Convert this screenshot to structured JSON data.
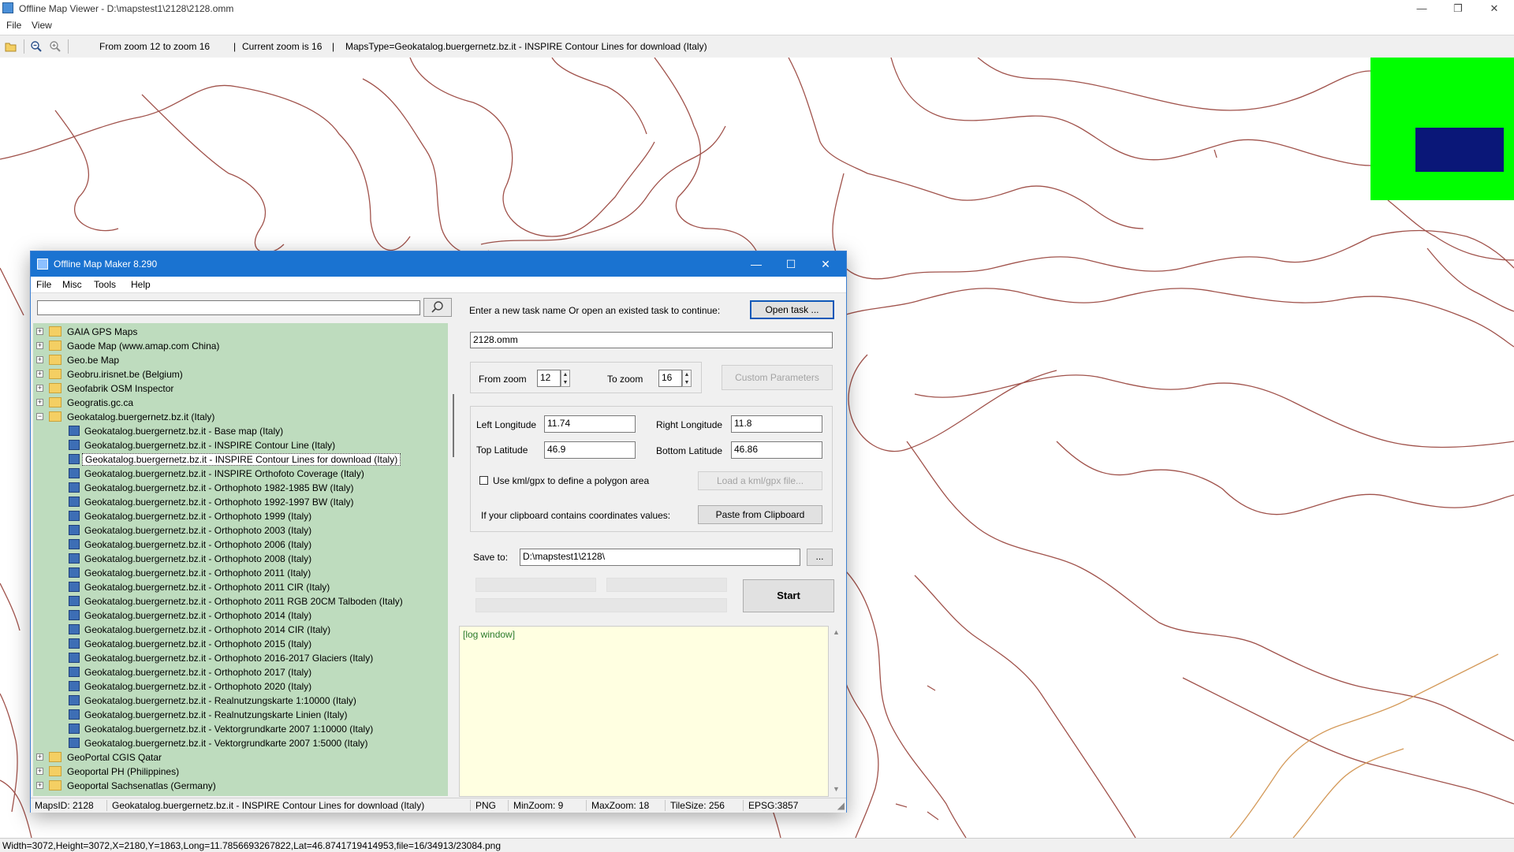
{
  "outer": {
    "title": "Offline Map Viewer - D:\\mapstest1\\2128\\2128.omm",
    "menu": [
      "File",
      "View"
    ],
    "toolbar": {
      "zoom_range": "From zoom 12 to zoom 16",
      "current_zoom": "Current zoom is 16",
      "maps_type": "MapsType=Geokatalog.buergernetz.bz.it - INSPIRE Contour Lines for download (Italy)",
      "sep1": "|",
      "sep2": "|"
    },
    "window_buttons": {
      "minimize": "—",
      "restore": "❐",
      "close": "✕"
    },
    "status": "Width=3072,Height=3072,X=2180,Y=1863,Long=11.7856693267822,Lat=46.8741719414953,file=16/34913/23084.png"
  },
  "colors": {
    "contour": "#a0524b",
    "contour_light": "#d49a5a",
    "minimap_bg": "#00ff00",
    "minimap_view": "#0a1778",
    "tree_bg": "#bedcbe",
    "titlebar": "#1a73d1",
    "log_bg": "#ffffe1"
  },
  "dialog": {
    "title": "Offline Map Maker 8.290",
    "window_buttons": {
      "minimize": "—",
      "maximize": "☐",
      "close": "✕"
    },
    "menu": [
      "File",
      "Misc",
      "Tools",
      "Help"
    ],
    "search": {
      "value": "",
      "placeholder": ""
    },
    "tree": [
      {
        "label": "GAIA GPS Maps",
        "kind": "folder",
        "level": 0,
        "expander": "+"
      },
      {
        "label": "Gaode Map (www.amap.com China)",
        "kind": "folder",
        "level": 0,
        "expander": "+"
      },
      {
        "label": "Geo.be Map",
        "kind": "folder",
        "level": 0,
        "expander": "+"
      },
      {
        "label": "Geobru.irisnet.be (Belgium)",
        "kind": "folder",
        "level": 0,
        "expander": "+"
      },
      {
        "label": "Geofabrik OSM Inspector",
        "kind": "folder",
        "level": 0,
        "expander": "+"
      },
      {
        "label": "Geogratis.gc.ca",
        "kind": "folder",
        "level": 0,
        "expander": "+"
      },
      {
        "label": "Geokatalog.buergernetz.bz.it (Italy)",
        "kind": "folder",
        "level": 0,
        "expander": "−"
      },
      {
        "label": "Geokatalog.buergernetz.bz.it - Base map (Italy)",
        "kind": "map",
        "level": 1
      },
      {
        "label": "Geokatalog.buergernetz.bz.it - INSPIRE Contour Line (Italy)",
        "kind": "map",
        "level": 1
      },
      {
        "label": "Geokatalog.buergernetz.bz.it - INSPIRE Contour Lines for download (Italy)",
        "kind": "map",
        "level": 1,
        "selected": true
      },
      {
        "label": "Geokatalog.buergernetz.bz.it - INSPIRE Orthofoto Coverage (Italy)",
        "kind": "map",
        "level": 1
      },
      {
        "label": "Geokatalog.buergernetz.bz.it - Orthophoto 1982-1985 BW (Italy)",
        "kind": "map",
        "level": 1
      },
      {
        "label": "Geokatalog.buergernetz.bz.it - Orthophoto 1992-1997 BW (Italy)",
        "kind": "map",
        "level": 1
      },
      {
        "label": "Geokatalog.buergernetz.bz.it - Orthophoto 1999 (Italy)",
        "kind": "map",
        "level": 1
      },
      {
        "label": "Geokatalog.buergernetz.bz.it - Orthophoto 2003 (Italy)",
        "kind": "map",
        "level": 1
      },
      {
        "label": "Geokatalog.buergernetz.bz.it - Orthophoto 2006 (Italy)",
        "kind": "map",
        "level": 1
      },
      {
        "label": "Geokatalog.buergernetz.bz.it - Orthophoto 2008 (Italy)",
        "kind": "map",
        "level": 1
      },
      {
        "label": "Geokatalog.buergernetz.bz.it - Orthophoto 2011 (Italy)",
        "kind": "map",
        "level": 1
      },
      {
        "label": "Geokatalog.buergernetz.bz.it - Orthophoto 2011 CIR (Italy)",
        "kind": "map",
        "level": 1
      },
      {
        "label": "Geokatalog.buergernetz.bz.it - Orthophoto 2011 RGB 20CM Talboden (Italy)",
        "kind": "map",
        "level": 1
      },
      {
        "label": "Geokatalog.buergernetz.bz.it - Orthophoto 2014 (Italy)",
        "kind": "map",
        "level": 1
      },
      {
        "label": "Geokatalog.buergernetz.bz.it - Orthophoto 2014 CIR (Italy)",
        "kind": "map",
        "level": 1
      },
      {
        "label": "Geokatalog.buergernetz.bz.it - Orthophoto 2015 (Italy)",
        "kind": "map",
        "level": 1
      },
      {
        "label": "Geokatalog.buergernetz.bz.it - Orthophoto 2016-2017 Glaciers (Italy)",
        "kind": "map",
        "level": 1
      },
      {
        "label": "Geokatalog.buergernetz.bz.it - Orthophoto 2017 (Italy)",
        "kind": "map",
        "level": 1
      },
      {
        "label": "Geokatalog.buergernetz.bz.it - Orthophoto 2020 (Italy)",
        "kind": "map",
        "level": 1
      },
      {
        "label": "Geokatalog.buergernetz.bz.it - Realnutzungskarte 1:10000 (Italy)",
        "kind": "map",
        "level": 1
      },
      {
        "label": "Geokatalog.buergernetz.bz.it - Realnutzungskarte Linien (Italy)",
        "kind": "map",
        "level": 1
      },
      {
        "label": "Geokatalog.buergernetz.bz.it - Vektorgrundkarte 2007 1:10000 (Italy)",
        "kind": "map",
        "level": 1
      },
      {
        "label": "Geokatalog.buergernetz.bz.it - Vektorgrundkarte 2007 1:5000 (Italy)",
        "kind": "map",
        "level": 1
      },
      {
        "label": "GeoPortal CGIS Qatar",
        "kind": "folder",
        "level": 0,
        "expander": "+"
      },
      {
        "label": "Geoportal PH (Philippines)",
        "kind": "folder",
        "level": 0,
        "expander": "+"
      },
      {
        "label": "Geoportal Sachsenatlas (Germany)",
        "kind": "folder",
        "level": 0,
        "expander": "+"
      }
    ],
    "task": {
      "prompt": "Enter a new task name Or open an existed task to continue:",
      "open_button": "Open task ...",
      "name_value": "2128.omm"
    },
    "zoom": {
      "from_label": "From zoom",
      "from_value": "12",
      "to_label": "To zoom",
      "to_value": "16",
      "custom_button": "Custom Parameters"
    },
    "coords": {
      "left_lon_label": "Left Longitude",
      "left_lon_value": "11.74",
      "right_lon_label": "Right Longitude",
      "right_lon_value": "11.8",
      "top_lat_label": "Top Latitude",
      "top_lat_value": "46.9",
      "bottom_lat_label": "Bottom Latitude",
      "bottom_lat_value": "46.86",
      "kml_checkbox_label": "Use kml/gpx to define a polygon area",
      "kml_checked": false,
      "load_kml_button": "Load a kml/gpx file...",
      "clipboard_label": "If your clipboard contains coordinates values:",
      "paste_button": "Paste from Clipboard"
    },
    "save": {
      "label": "Save to:",
      "path": "D:\\mapstest1\\2128\\",
      "browse_button": "...",
      "start_button": "Start",
      "progress": [
        0,
        0,
        0
      ]
    },
    "log": {
      "text": "[log window]"
    },
    "status": {
      "maps_id": "MapsID: 2128",
      "maps_name": "Geokatalog.buergernetz.bz.it - INSPIRE Contour Lines for download (Italy)",
      "format": "PNG",
      "min_zoom": "MinZoom: 9",
      "max_zoom": "MaxZoom: 18",
      "tile_size": "TileSize: 256",
      "epsg": "EPSG:3857"
    }
  }
}
